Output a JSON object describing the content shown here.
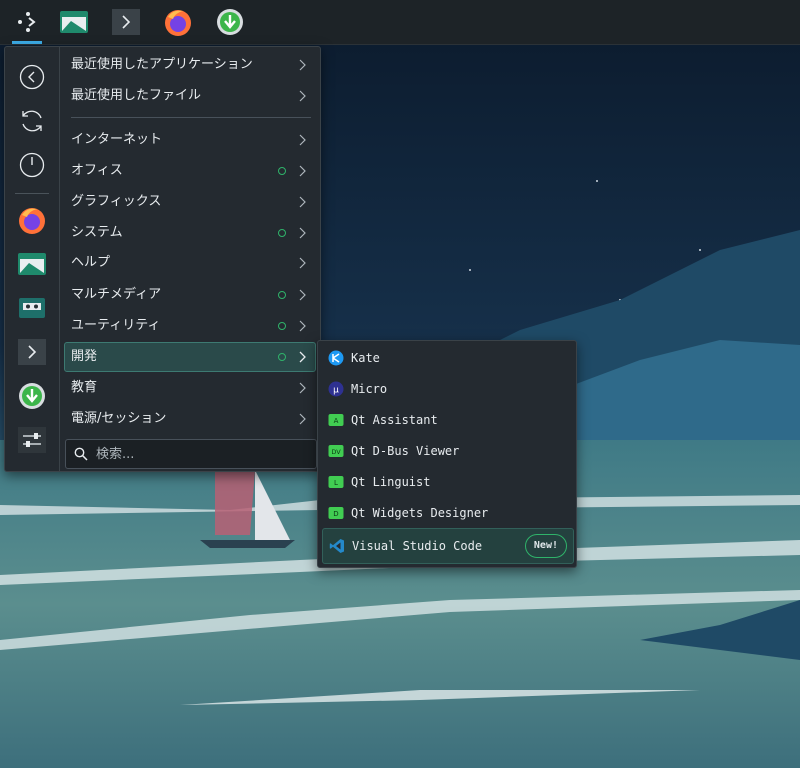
{
  "taskbar": {
    "launchers": [
      {
        "name": "app-launcher-icon"
      },
      {
        "name": "file-manager-icon"
      },
      {
        "name": "terminal-icon"
      },
      {
        "name": "firefox-icon"
      },
      {
        "name": "software-update-icon"
      }
    ]
  },
  "sidebar": {
    "buttons": [
      {
        "icon": "back-icon"
      },
      {
        "icon": "refresh-icon"
      },
      {
        "icon": "power-icon"
      },
      {
        "icon": "firefox-icon"
      },
      {
        "icon": "file-manager-icon"
      },
      {
        "icon": "cassette-icon"
      },
      {
        "icon": "terminal-icon"
      },
      {
        "icon": "software-update-icon"
      },
      {
        "icon": "settings-sliders-icon"
      }
    ]
  },
  "menu": {
    "categories": [
      {
        "label": "最近使用したアプリケーション",
        "new_dot": false
      },
      {
        "label": "最近使用したファイル",
        "new_dot": false
      },
      {
        "label": "インターネット",
        "new_dot": false
      },
      {
        "label": "オフィス",
        "new_dot": true
      },
      {
        "label": "グラフィックス",
        "new_dot": false
      },
      {
        "label": "システム",
        "new_dot": true
      },
      {
        "label": "ヘルプ",
        "new_dot": false
      },
      {
        "label": "マルチメディア",
        "new_dot": true
      },
      {
        "label": "ユーティリティ",
        "new_dot": true
      },
      {
        "label": "開発",
        "new_dot": true,
        "selected": true
      },
      {
        "label": "教育",
        "new_dot": false
      },
      {
        "label": "電源/セッション",
        "new_dot": false
      }
    ],
    "search": {
      "placeholder": "検索..."
    }
  },
  "submenu": {
    "items": [
      {
        "label": "Kate",
        "icon": "kate-icon"
      },
      {
        "label": "Micro",
        "icon": "micro-icon"
      },
      {
        "label": "Qt Assistant",
        "icon": "qt-assistant-icon",
        "glyph": "A"
      },
      {
        "label": "Qt D-Bus Viewer",
        "icon": "qt-dbus-viewer-icon",
        "glyph": "DV"
      },
      {
        "label": "Qt Linguist",
        "icon": "qt-linguist-icon",
        "glyph": "L"
      },
      {
        "label": "Qt Widgets Designer",
        "icon": "qt-designer-icon",
        "glyph": "D"
      },
      {
        "label": "Visual Studio Code",
        "icon": "vscode-icon",
        "badge": "New!"
      }
    ]
  },
  "colors": {
    "accent": "#3daee9",
    "new_indicator": "#2fb36a",
    "menu_bg": "#242a30",
    "selected_bg": "#2a4a4a"
  }
}
